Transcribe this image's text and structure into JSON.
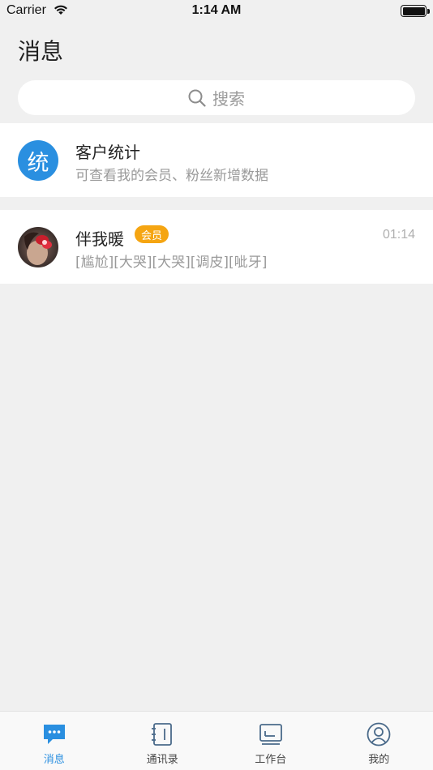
{
  "status_bar": {
    "carrier": "Carrier",
    "time": "1:14 AM"
  },
  "page": {
    "title": "消息"
  },
  "search": {
    "placeholder": "搜索"
  },
  "conversations": [
    {
      "avatar_text": "统",
      "title": "客户统计",
      "subtitle": "可查看我的会员、粉丝新增数据",
      "avatar_color": "#2a8fe0"
    },
    {
      "title": "伴我暖",
      "badge": "会员",
      "preview": "[尴尬][大哭][大哭][调皮][呲牙]",
      "time": "01:14",
      "badge_color": "#f5a512"
    }
  ],
  "tabs": [
    {
      "label": "消息",
      "icon": "chat-bubble-icon",
      "active": true
    },
    {
      "label": "通讯录",
      "icon": "contacts-book-icon",
      "active": false
    },
    {
      "label": "工作台",
      "icon": "desk-board-icon",
      "active": false
    },
    {
      "label": "我的",
      "icon": "user-profile-icon",
      "active": false
    }
  ],
  "colors": {
    "accent": "#2a8fe0",
    "badge": "#f5a512",
    "background": "#f0f0f0"
  }
}
